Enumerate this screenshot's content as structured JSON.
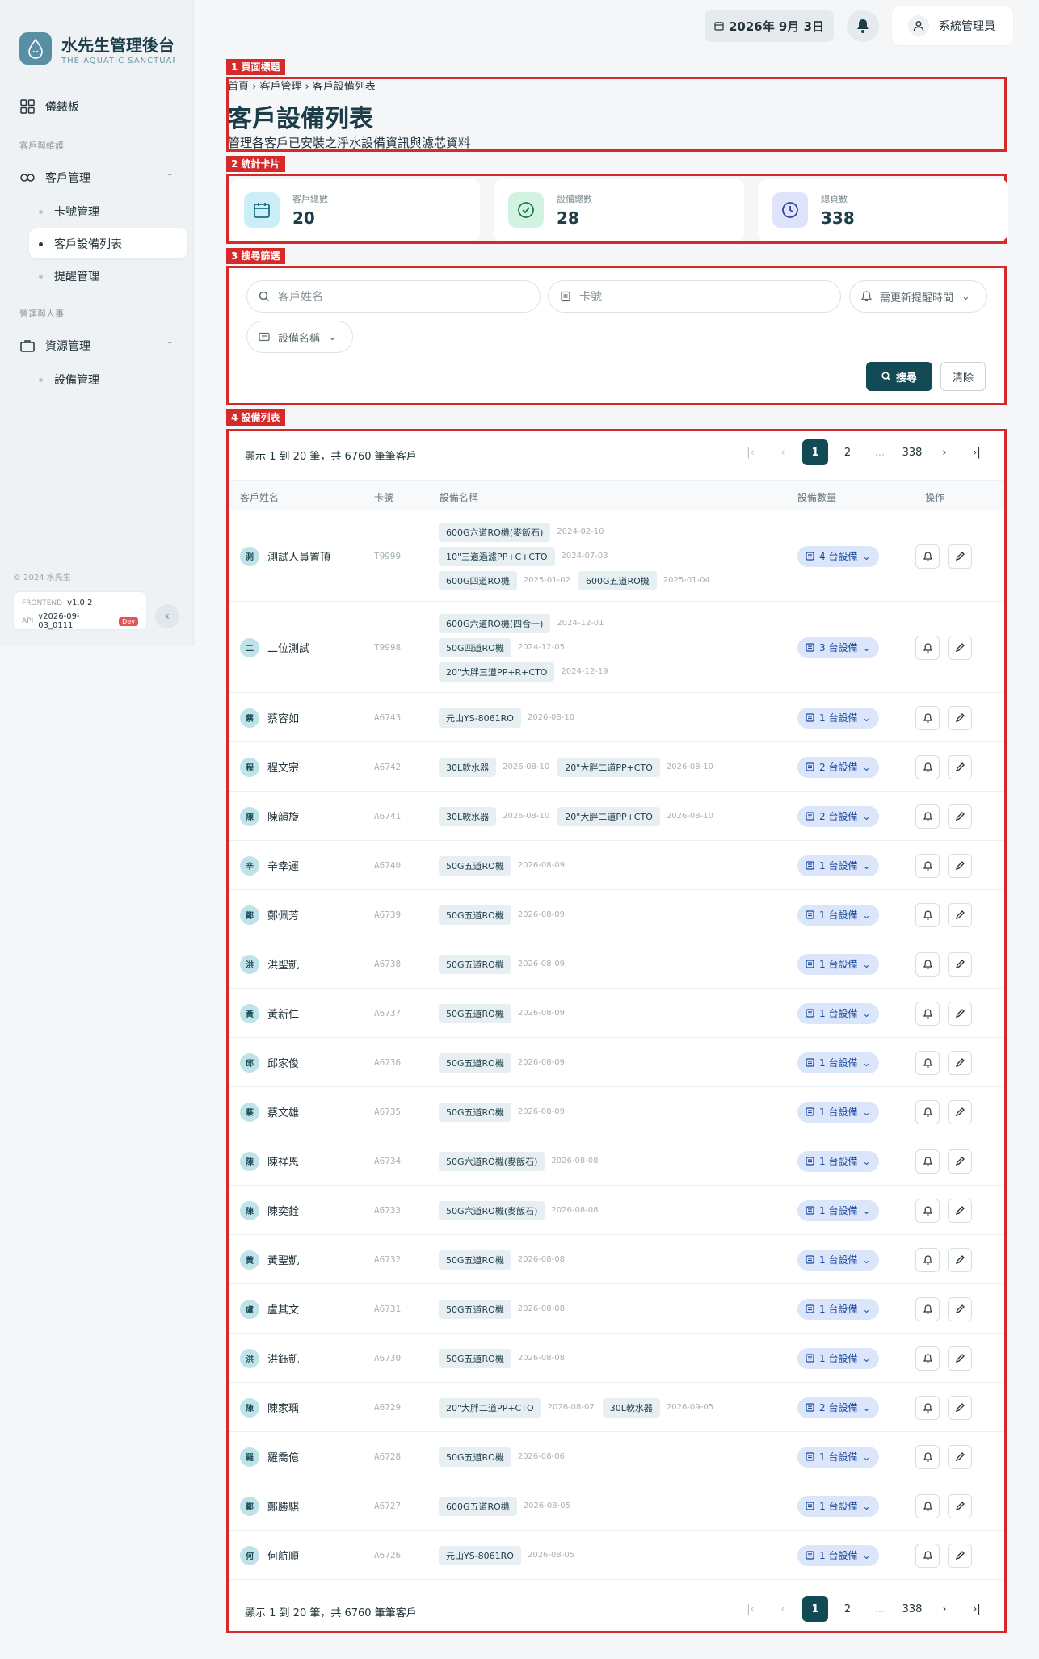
{
  "sidebar": {
    "brand_title": "水先生管理後台",
    "brand_sub": "THE AQUATIC SANCTUARY",
    "dashboard": "儀錶板",
    "section_customers": "客戶與維護",
    "customer_mgmt": "客戶管理",
    "sub_card": "卡號管理",
    "sub_devices": "客戶設備列表",
    "sub_reminder": "提醒管理",
    "section_ops": "營運與人事",
    "resource_mgmt": "資源管理",
    "sub_equipment": "設備管理",
    "copyright": "© 2024 水先生",
    "frontend_label": "FRONTEND",
    "frontend_ver": "v1.0.2",
    "api_label": "API",
    "api_ver": "v2026-09-03_0111",
    "env": "Dev"
  },
  "topbar": {
    "date": "2026年 9月 3日",
    "user": "系統管理員"
  },
  "labels": {
    "s1": "1 頁面標題",
    "s2": "2 統計卡片",
    "s3": "3 搜尋篩選",
    "s4": "4 設備列表"
  },
  "header": {
    "breadcrumb": "首頁 › 客戶管理 › 客戶設備列表",
    "title": "客戶設備列表",
    "description": "管理各客戶已安裝之淨水設備資訊與濾芯資料"
  },
  "stats": [
    {
      "label": "客戶總數",
      "value": "20"
    },
    {
      "label": "設備總數",
      "value": "28"
    },
    {
      "label": "總頁數",
      "value": "338"
    }
  ],
  "filters": {
    "customer_placeholder": "客戶姓名",
    "card_placeholder": "卡號",
    "reminder": "需更新提醒時間",
    "device": "設備名稱",
    "search": "搜尋",
    "clear": "清除"
  },
  "pager": {
    "info": "顯示 1 到 20 筆，共 6760 筆筆客戶",
    "pages": [
      "1",
      "2",
      "...",
      "338"
    ]
  },
  "columns": {
    "customer": "客戶姓名",
    "card": "卡號",
    "device": "設備名稱",
    "count": "設備數量",
    "actions": "操作"
  },
  "rows": [
    {
      "initial": "測",
      "name": "測試人員置頂",
      "card": "T9999",
      "count": "4 台設備",
      "lines": [
        [
          [
            "600G六道RO機(麥飯石)",
            "2024-02-10"
          ]
        ],
        [
          [
            "10\"三道過濾PP+C+CTO",
            "2024-07-03"
          ]
        ],
        [
          [
            "600G四道RO機",
            "2025-01-02"
          ],
          [
            "600G五道RO機",
            "2025-01-04"
          ]
        ]
      ]
    },
    {
      "initial": "二",
      "name": "二位測試",
      "card": "T9998",
      "count": "3 台設備",
      "lines": [
        [
          [
            "600G六道RO機(四合一)",
            "2024-12-01"
          ]
        ],
        [
          [
            "50G四道RO機",
            "2024-12-05"
          ]
        ],
        [
          [
            "20\"大胖三道PP+R+CTO",
            "2024-12-19"
          ]
        ]
      ]
    },
    {
      "initial": "蔡",
      "name": "蔡容如",
      "card": "A6743",
      "count": "1 台設備",
      "lines": [
        [
          [
            "元山YS-8061RO",
            "2026-08-10"
          ]
        ]
      ]
    },
    {
      "initial": "程",
      "name": "程文宗",
      "card": "A6742",
      "count": "2 台設備",
      "lines": [
        [
          [
            "30L軟水器",
            "2026-08-10"
          ],
          [
            "20\"大胖二道PP+CTO",
            "2026-08-10"
          ]
        ]
      ]
    },
    {
      "initial": "陳",
      "name": "陳韻旋",
      "card": "A6741",
      "count": "2 台設備",
      "lines": [
        [
          [
            "30L軟水器",
            "2026-08-10"
          ],
          [
            "20\"大胖二道PP+CTO",
            "2026-08-10"
          ]
        ]
      ]
    },
    {
      "initial": "辛",
      "name": "辛幸運",
      "card": "A6740",
      "count": "1 台設備",
      "lines": [
        [
          [
            "50G五道RO機",
            "2026-08-09"
          ]
        ]
      ]
    },
    {
      "initial": "鄭",
      "name": "鄭佩芳",
      "card": "A6739",
      "count": "1 台設備",
      "lines": [
        [
          [
            "50G五道RO機",
            "2026-08-09"
          ]
        ]
      ]
    },
    {
      "initial": "洪",
      "name": "洪聖凱",
      "card": "A6738",
      "count": "1 台設備",
      "lines": [
        [
          [
            "50G五道RO機",
            "2026-08-09"
          ]
        ]
      ]
    },
    {
      "initial": "黃",
      "name": "黃新仁",
      "card": "A6737",
      "count": "1 台設備",
      "lines": [
        [
          [
            "50G五道RO機",
            "2026-08-09"
          ]
        ]
      ]
    },
    {
      "initial": "邱",
      "name": "邱家俊",
      "card": "A6736",
      "count": "1 台設備",
      "lines": [
        [
          [
            "50G五道RO機",
            "2026-08-09"
          ]
        ]
      ]
    },
    {
      "initial": "蔡",
      "name": "蔡文雄",
      "card": "A6735",
      "count": "1 台設備",
      "lines": [
        [
          [
            "50G五道RO機",
            "2026-08-09"
          ]
        ]
      ]
    },
    {
      "initial": "陳",
      "name": "陳祥恩",
      "card": "A6734",
      "count": "1 台設備",
      "lines": [
        [
          [
            "50G六道RO機(麥飯石)",
            "2026-08-08"
          ]
        ]
      ]
    },
    {
      "initial": "陳",
      "name": "陳奕銓",
      "card": "A6733",
      "count": "1 台設備",
      "lines": [
        [
          [
            "50G六道RO機(麥飯石)",
            "2026-08-08"
          ]
        ]
      ]
    },
    {
      "initial": "黃",
      "name": "黃聖凱",
      "card": "A6732",
      "count": "1 台設備",
      "lines": [
        [
          [
            "50G五道RO機",
            "2026-08-08"
          ]
        ]
      ]
    },
    {
      "initial": "盧",
      "name": "盧其文",
      "card": "A6731",
      "count": "1 台設備",
      "lines": [
        [
          [
            "50G五道RO機",
            "2026-08-08"
          ]
        ]
      ]
    },
    {
      "initial": "洪",
      "name": "洪鈺凱",
      "card": "A6730",
      "count": "1 台設備",
      "lines": [
        [
          [
            "50G五道RO機",
            "2026-08-08"
          ]
        ]
      ]
    },
    {
      "initial": "陳",
      "name": "陳家瑀",
      "card": "A6729",
      "count": "2 台設備",
      "lines": [
        [
          [
            "20\"大胖二道PP+CTO",
            "2026-08-07"
          ],
          [
            "30L軟水器",
            "2026-09-05"
          ]
        ]
      ]
    },
    {
      "initial": "羅",
      "name": "羅喬億",
      "card": "A6728",
      "count": "1 台設備",
      "lines": [
        [
          [
            "50G五道RO機",
            "2026-08-06"
          ]
        ]
      ]
    },
    {
      "initial": "鄭",
      "name": "鄭勝騏",
      "card": "A6727",
      "count": "1 台設備",
      "lines": [
        [
          [
            "600G五道RO機",
            "2026-08-05"
          ]
        ]
      ]
    },
    {
      "initial": "何",
      "name": "何航順",
      "card": "A6726",
      "count": "1 台設備",
      "lines": [
        [
          [
            "元山YS-8061RO",
            "2026-08-05"
          ]
        ]
      ]
    }
  ]
}
